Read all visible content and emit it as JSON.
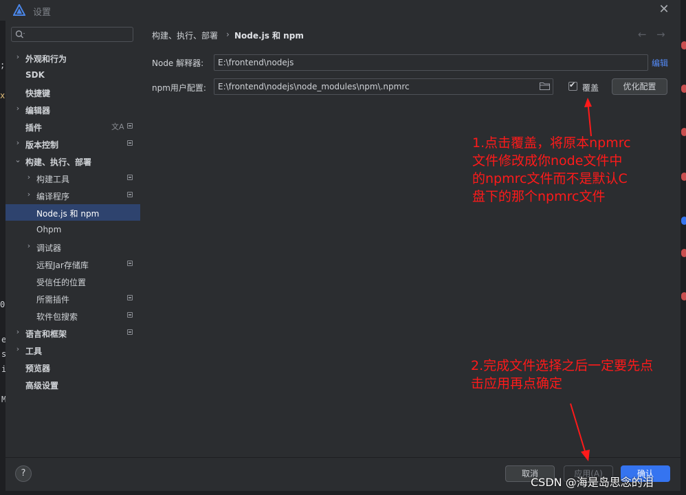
{
  "window": {
    "title": "设置"
  },
  "search": {
    "placeholder": ""
  },
  "sidebar": {
    "items": [
      {
        "label": "外观和行为",
        "chevron": "›",
        "bold": true
      },
      {
        "label": "SDK",
        "bold": true
      },
      {
        "label": "快捷键",
        "bold": true
      },
      {
        "label": "编辑器",
        "chevron": "›",
        "bold": true
      },
      {
        "label": "插件",
        "bold": true,
        "badge": true,
        "translate_icon": true
      },
      {
        "label": "版本控制",
        "chevron": "›",
        "bold": true,
        "badge": true
      },
      {
        "label": "构建、执行、部署",
        "chevron": "⌄",
        "bold": true
      },
      {
        "label": "构建工具",
        "chevron": "›",
        "badge": true
      },
      {
        "label": "编译程序",
        "chevron": "›",
        "badge": true
      },
      {
        "label": "Node.js 和 npm",
        "selected": true
      },
      {
        "label": "Ohpm"
      },
      {
        "label": "调试器",
        "chevron": "›"
      },
      {
        "label": "远程Jar存储库",
        "badge": true
      },
      {
        "label": "受信任的位置"
      },
      {
        "label": "所需插件",
        "badge": true
      },
      {
        "label": "软件包搜索",
        "badge": true
      },
      {
        "label": "语言和框架",
        "chevron": "›",
        "bold": true,
        "badge": true
      },
      {
        "label": "工具",
        "chevron": "›",
        "bold": true
      },
      {
        "label": "预览器",
        "bold": true
      },
      {
        "label": "高级设置",
        "bold": true
      }
    ]
  },
  "breadcrumb": {
    "parent": "构建、执行、部署",
    "separator": "›",
    "current": "Node.js 和 npm"
  },
  "form": {
    "node_label": "Node 解释器:",
    "node_value": "E:\\frontend\\nodejs",
    "edit_link": "编辑",
    "npm_label": "npm用户配置:",
    "npm_value": "E:\\frontend\\nodejs\\node_modules\\npm\\.npmrc",
    "override_label": "覆盖",
    "override_checked": true,
    "optimize_button": "优化配置"
  },
  "footer": {
    "cancel": "取消",
    "apply": "应用(A)",
    "ok": "确认"
  },
  "annotations": {
    "note1": [
      "1.点击覆盖，将原本npmrc",
      "文件修改成你node文件中",
      "的npmrc文件而不是默认C",
      "盘下的那个npmrc文件"
    ],
    "note2": [
      "2.完成文件选择之后一定要先点",
      "击应用再点确定"
    ]
  },
  "watermark": "CSDN @海是岛思念的泪",
  "background_fragments": [
    ";",
    "x",
    "0",
    "e",
    "s",
    "i",
    "M"
  ],
  "colors": {
    "accent": "#3574f0",
    "selection": "#2e436e",
    "annotation": "#ff1a1a",
    "link": "#548af7"
  }
}
